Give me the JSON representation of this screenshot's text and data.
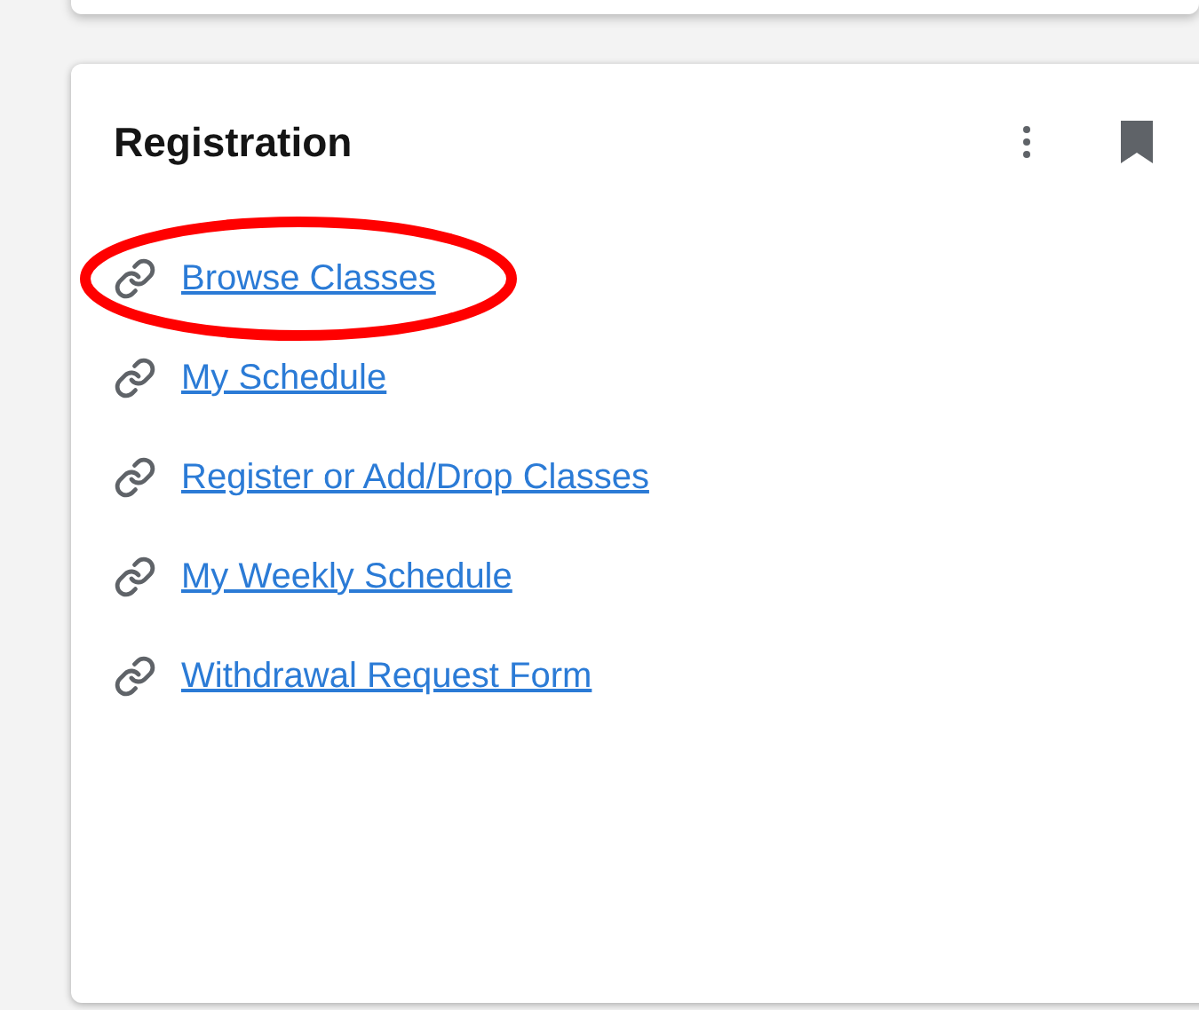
{
  "card": {
    "title": "Registration",
    "links": [
      {
        "label": "Browse Classes",
        "circled": true
      },
      {
        "label": "My Schedule",
        "circled": false
      },
      {
        "label": "Register or Add/Drop Classes",
        "circled": false
      },
      {
        "label": "My Weekly Schedule",
        "circled": false
      },
      {
        "label": "Withdrawal Request Form",
        "circled": false
      }
    ]
  }
}
